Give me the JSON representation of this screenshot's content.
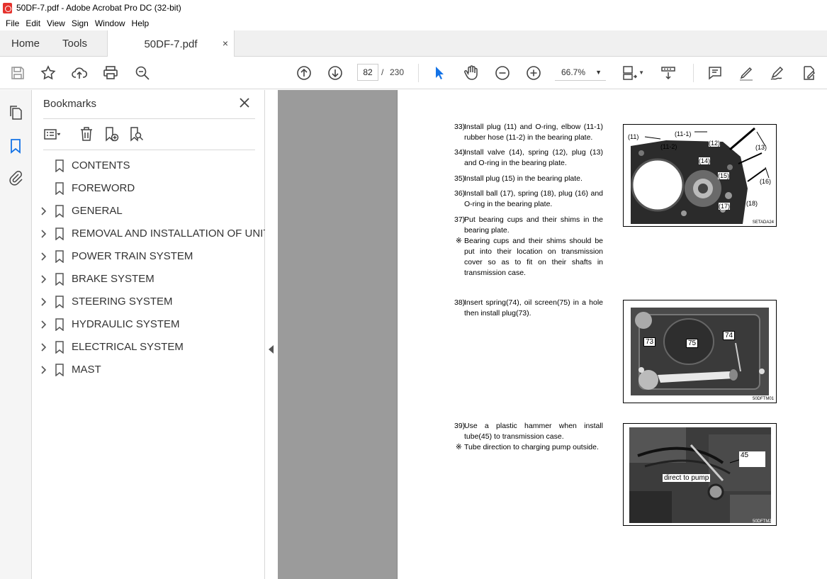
{
  "window": {
    "title": "50DF-7.pdf - Adobe Acrobat Pro DC (32-bit)"
  },
  "menu": [
    "File",
    "Edit",
    "View",
    "Sign",
    "Window",
    "Help"
  ],
  "tabs": {
    "home": "Home",
    "tools": "Tools",
    "document": "50DF-7.pdf",
    "close_glyph": "×"
  },
  "toolbar": {
    "current_page": "82",
    "page_separator": "/",
    "total_pages": "230",
    "zoom": "66.7%"
  },
  "bookmarks": {
    "title": "Bookmarks",
    "items": [
      {
        "label": "CONTENTS",
        "expandable": false
      },
      {
        "label": "FOREWORD",
        "expandable": false
      },
      {
        "label": "GENERAL",
        "expandable": true
      },
      {
        "label": "REMOVAL AND INSTALLATION OF UNIT",
        "expandable": true
      },
      {
        "label": "POWER TRAIN SYSTEM",
        "expandable": true
      },
      {
        "label": "BRAKE SYSTEM",
        "expandable": true
      },
      {
        "label": "STEERING SYSTEM",
        "expandable": true
      },
      {
        "label": "HYDRAULIC SYSTEM",
        "expandable": true
      },
      {
        "label": "ELECTRICAL SYSTEM",
        "expandable": true
      },
      {
        "label": "MAST",
        "expandable": true
      }
    ]
  },
  "document": {
    "steps": [
      {
        "num": "33)",
        "text": "Install plug (11) and O-ring, elbow (11-1) rubber hose (11-2) in the bearing plate."
      },
      {
        "num": "34)",
        "text": "Install valve (14), spring (12), plug (13) and O-ring in the bearing plate."
      },
      {
        "num": "35)",
        "text": "Install plug (15) in the bearing plate."
      },
      {
        "num": "36)",
        "text": "Install ball (17), spring (18), plug (16) and O-ring in the bearing plate."
      },
      {
        "num": "37)",
        "text": "Put bearing cups and their shims  in the bearing plate."
      },
      {
        "num": "※",
        "text": "Bearing cups and their shims should be put into their location on transmission cover so as to fit on their shafts in transmission case."
      },
      {
        "num": "38)",
        "text": "Insert spring(74), oil screen(75) in a hole then install plug(73)."
      },
      {
        "num": "39)",
        "text": "Use a plastic hammer when install tube(45) to transmission case."
      },
      {
        "num": "※",
        "text": "Tube direction to charging pump outside."
      }
    ],
    "figures": {
      "fig1": {
        "code": "SETADA24",
        "callouts": [
          "(11)",
          "(11-1)",
          "(11-2)",
          "(12)",
          "(13)",
          "(14)",
          "(15)",
          "(16)",
          "(17)",
          "(18)"
        ]
      },
      "fig2": {
        "code": "50DFTM01",
        "labels": [
          "73",
          "75",
          "74"
        ]
      },
      "fig3": {
        "code": "50DFTM21",
        "labels": [
          "45",
          "direct to pump"
        ]
      }
    }
  },
  "colors": {
    "acrobat_red": "#e5322d",
    "select_blue": "#1473e6",
    "doc_background": "#9b9b9b"
  }
}
